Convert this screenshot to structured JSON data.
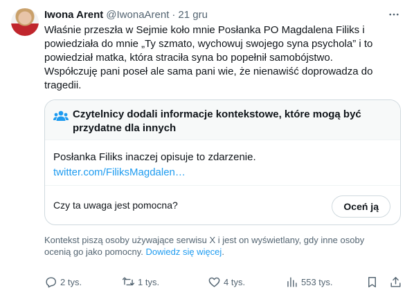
{
  "tweet": {
    "author_name": "Iwona Arent",
    "author_handle": "@IwonaArent",
    "separator": "·",
    "time": "21 gru",
    "text_lines": [
      "Właśnie przeszła w Sejmie koło mnie Posłanka PO Magdalena Filiks i",
      "powiedziała do mnie „Ty szmato, wychowuj swojego syna psychola” i to",
      "powiedział matka, która straciła syna bo popełnił samobójstwo.",
      "Współczuję pani poseł ale sama pani wie, że nienawiść doprowadza do",
      "tragedii."
    ]
  },
  "community_note": {
    "title": "Czytelnicy dodali informacje kontekstowe, które mogą być przydatne dla innych",
    "body": "Posłanka Filiks inaczej opisuje to zdarzenie.",
    "link": "twitter.com/FiliksMagdalen…",
    "question": "Czy ta uwaga jest pomocna?",
    "rate_label": "Oceń ją"
  },
  "footnote": {
    "text": "Kontekst piszą osoby używające serwisu X i jest on wyświetlany, gdy inne osoby ocenią go jako pomocny.",
    "link": "Dowiedz się więcej",
    "end": "."
  },
  "actions": {
    "replies": "2 tys.",
    "reposts": "1 tys.",
    "likes": "4 tys.",
    "views": "553 tys."
  },
  "colors": {
    "link": "#1d9bf0",
    "secondary_text": "#536471",
    "border": "#cfd9de"
  },
  "icons": [
    "more-icon",
    "community-notes-icon",
    "reply-icon",
    "repost-icon",
    "like-icon",
    "views-icon",
    "bookmark-icon",
    "share-icon"
  ]
}
